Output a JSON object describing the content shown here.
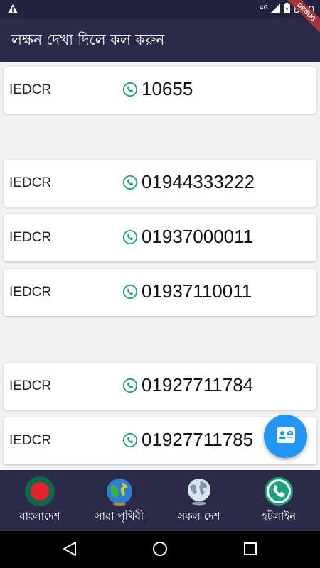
{
  "status_bar": {
    "time": "8:40",
    "network": "4G",
    "debug_label": "DEBUG"
  },
  "app_bar": {
    "title": "লক্ষন দেখা দিলে কল করুন"
  },
  "contacts": [
    {
      "org": "IEDCR",
      "number": "10655"
    },
    {
      "org": "IEDCR",
      "number": "01944333222"
    },
    {
      "org": "IEDCR",
      "number": "01937000011"
    },
    {
      "org": "IEDCR",
      "number": "01937110011"
    },
    {
      "org": "IEDCR",
      "number": "01927711784"
    },
    {
      "org": "IEDCR",
      "number": "01927711785"
    }
  ],
  "fab": {
    "icon": "contact-mail-icon"
  },
  "bottom_nav": {
    "items": [
      {
        "label": "বাংলাদেশ",
        "icon": "bangladesh-flag-icon"
      },
      {
        "label": "সারা পৃথিবী",
        "icon": "globe-icon"
      },
      {
        "label": "সকল দেশ",
        "icon": "world-map-icon"
      },
      {
        "label": "হটলাইন",
        "icon": "phone-icon"
      }
    ]
  },
  "colors": {
    "app_bar": "#2b2b49",
    "phone_icon": "#1aa37a",
    "fab": "#2196f3",
    "debug_ribbon": "#a8353c"
  }
}
